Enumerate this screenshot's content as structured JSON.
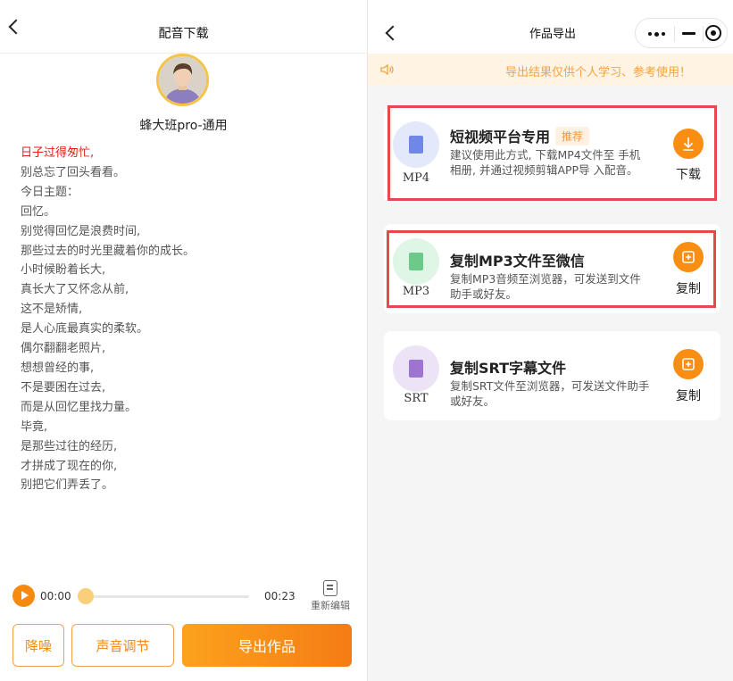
{
  "left": {
    "title": "配音下载",
    "voice_name": "蜂大班pro-通用",
    "lyrics": [
      "日子过得匆忙,",
      "别总忘了回头看看。",
      "今日主题：",
      "回忆。",
      "别觉得回忆是浪费时间,",
      "那些过去的时光里藏着你的成长。",
      "小时候盼着长大,",
      "真长大了又怀念从前,",
      "这不是矫情,",
      "是人心底最真实的柔软。",
      "偶尔翻翻老照片,",
      "想想曾经的事,",
      "不是要困在过去,",
      "而是从回忆里找力量。",
      "毕竟,",
      "是那些过往的经历,",
      "才拼成了现在的你,",
      "别把它们弄丢了。"
    ],
    "player": {
      "current_time": "00:00",
      "duration": "00:23",
      "progress": 0,
      "reedit_label": "重新编辑"
    },
    "buttons": {
      "denoise": "降噪",
      "sound_adjust": "声音调节",
      "export": "导出作品"
    }
  },
  "right": {
    "title": "作品导出",
    "notice": "导出结果仅供个人学习、参考使用！",
    "cards": [
      {
        "format": "MP4",
        "title": "短视频平台专用",
        "tag": "推荐",
        "desc": "建议使用此方式, 下载MP4文件至 手机相册, 并通过视频剪辑APP导 入配音。",
        "action": "下载",
        "icon": "download-icon"
      },
      {
        "format": "MP3",
        "title": "复制MP3文件至微信",
        "desc": "复制MP3音频至浏览器，可发送到文件助手或好友。",
        "action": "复制",
        "icon": "copy-icon"
      },
      {
        "format": "SRT",
        "title": "复制SRT字幕文件",
        "desc": "复制SRT文件至浏览器，可发送文件助手或好友。",
        "action": "复制",
        "icon": "copy-icon"
      }
    ]
  },
  "colors": {
    "accent": "#f68a0f",
    "highlight_red": "#e0201b",
    "notice_text": "#f5a33f",
    "annotation_box": "#e5484d"
  }
}
